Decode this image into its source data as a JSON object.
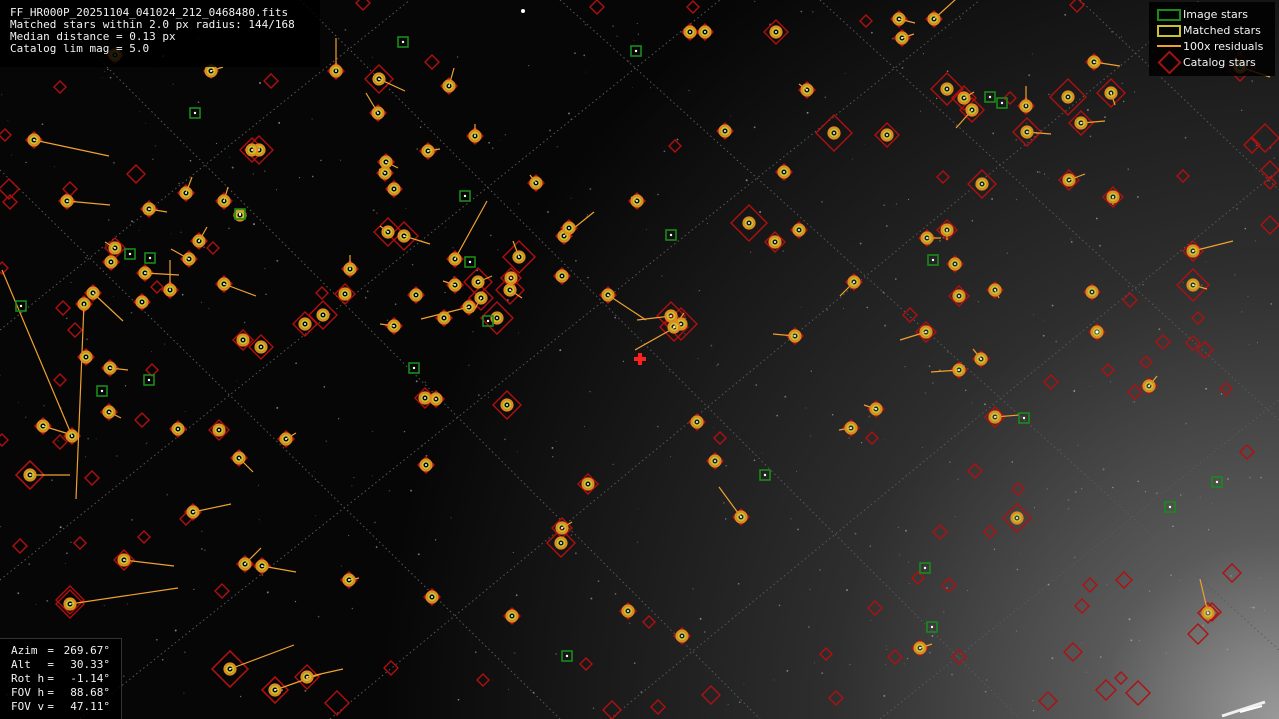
{
  "header": {
    "filename": "FF_HR000P_20251104_041024_212_0468480.fits",
    "matched_line": "Matched stars within 2.0 px radius: 144/168",
    "median_line": "Median distance = 0.13 px",
    "limmag_line": "Catalog lim mag = 5.0"
  },
  "legend": {
    "items": [
      {
        "label": "Image stars",
        "symbol": "image-star-square-icon"
      },
      {
        "label": "Matched stars",
        "symbol": "matched-star-circle-icon"
      },
      {
        "label": "100x residuals",
        "symbol": "residual-line-icon"
      },
      {
        "label": "Catalog stars",
        "symbol": "catalog-star-diamond-icon"
      }
    ]
  },
  "pointing": {
    "rows": [
      {
        "key": "Azim",
        "value": "269.67°"
      },
      {
        "key": "Alt",
        "value": "30.33°"
      },
      {
        "key": "Rot h",
        "value": "-1.14°"
      },
      {
        "key": "FOV h",
        "value": "88.68°"
      },
      {
        "key": "FOV v",
        "value": "47.11°"
      }
    ]
  },
  "colors": {
    "background": "#000000",
    "catalog": "#b01010",
    "matched": "#c8c230",
    "residual": "#f0a030",
    "image_star": "#1a8a1a",
    "center_marker": "#ff2020",
    "grid": "#5a5a5a"
  }
}
